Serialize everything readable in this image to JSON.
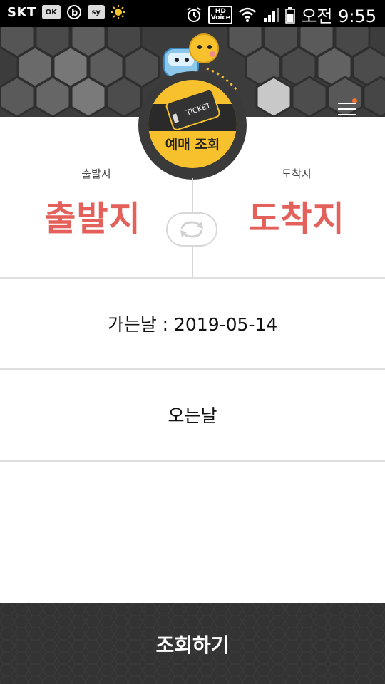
{
  "status_bar": {
    "carrier": "SKT",
    "time": "오전 9:55",
    "ok_badge": "OK",
    "sy_badge": "sy",
    "hd_label": "HD",
    "hd_sub": "Voice",
    "icons": [
      "ok-cashbag-icon",
      "b-circle-icon",
      "sy-icon",
      "sun-icon",
      "alarm-icon",
      "hd-voice-icon",
      "wifi-icon",
      "signal-icon",
      "battery-icon"
    ]
  },
  "header": {
    "badge_label": "예매 조회",
    "ticket_text": "TICKET",
    "menu_icon": "hamburger-menu-icon",
    "colors": {
      "background": "#3c3c3c",
      "badge": "#f6c12c",
      "accent_dot": "#f07030"
    }
  },
  "route": {
    "departure_label": "출발지",
    "departure_value": "출발지",
    "arrival_label": "도착지",
    "arrival_value": "도착지",
    "swap_icon": "swap-arrows-icon",
    "value_color": "#e4605a"
  },
  "dates": {
    "departure_date": "가는날 : 2019-05-14",
    "return_date": "오는날"
  },
  "search_button": {
    "label": "조회하기",
    "color": "#333333"
  }
}
